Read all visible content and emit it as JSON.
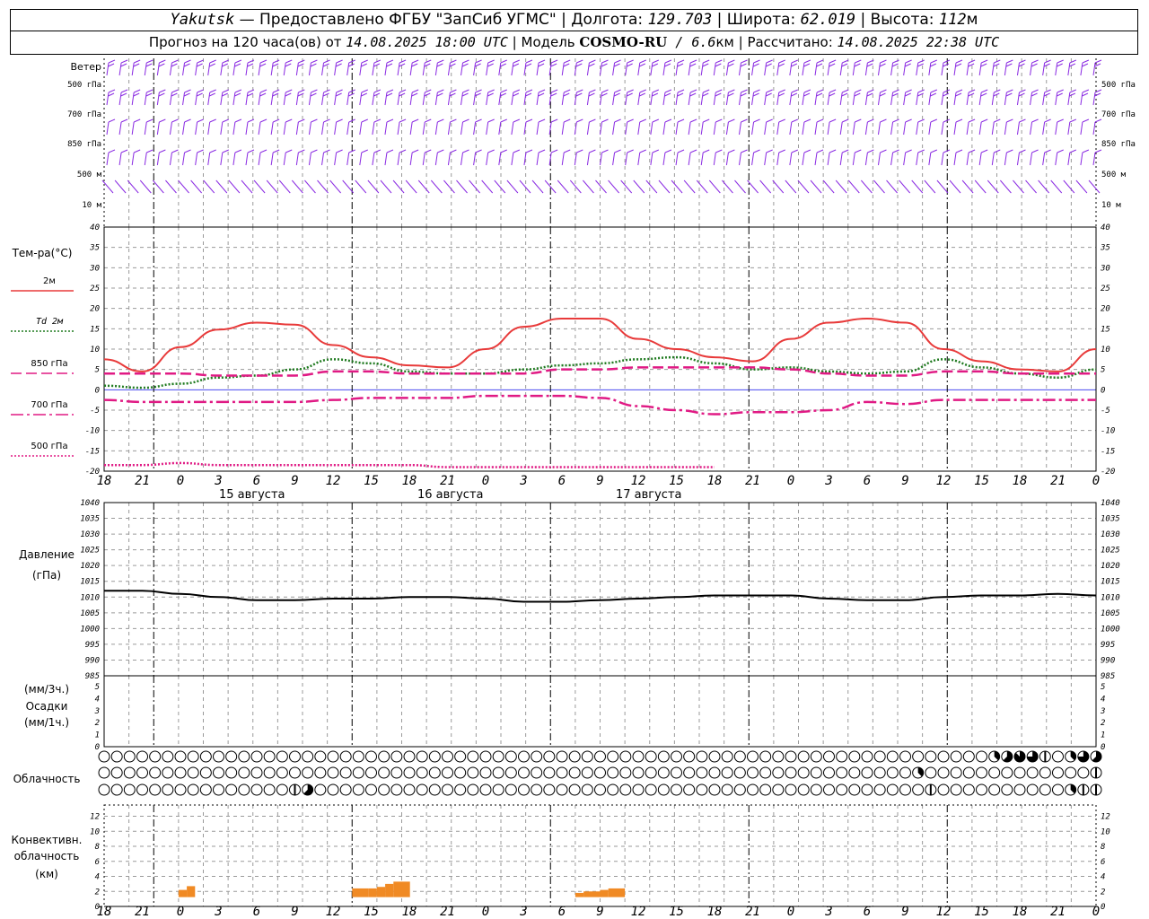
{
  "header": {
    "station": "Yakutsk",
    "dash": " — ",
    "provider": "Предоставлено ФГБУ \"ЗапСиб УГМС\"",
    "sep": " | ",
    "lon_label": "Долгота: ",
    "lon": "129.703",
    "lat_label": "Широта: ",
    "lat": "62.019",
    "alt_label": "Высота: ",
    "alt": "112",
    "alt_unit": "м",
    "forecast_label": "Прогноз на 120 часа(ов) от ",
    "forecast_start": "14.08.2025 18:00 UTC",
    "model_label": "Модель ",
    "model": "COSMO-RU",
    "model_res": " / 6.6",
    "model_res_unit": "км",
    "calc_label": "Рассчитано: ",
    "calc_time": "14.08.2025 22:38 UTC"
  },
  "colors": {
    "wind": "#8a2be2",
    "t2m": "#e83a3a",
    "td2m": "#1f7a1f",
    "t850": "#e01a84",
    "t700": "#e01a84",
    "t500": "#e01a84",
    "pressure": "#000000",
    "convective": "#f08a24",
    "grid": "#9a9a9a",
    "zero_line": "#4a4af0"
  },
  "chart_data": [
    {
      "type": "wind_barbs",
      "title": "Ветер",
      "levels": [
        "500 гПа",
        "700 гПа",
        "850 гПа",
        "500 м",
        "10 м"
      ],
      "x_hours": [
        18,
        19,
        20,
        21,
        22,
        23,
        0,
        1,
        2,
        3,
        4,
        5,
        6,
        7,
        8,
        9,
        10,
        11,
        12,
        13,
        14,
        15,
        16,
        17,
        18,
        19,
        20,
        21,
        22,
        23,
        0,
        1,
        2,
        3,
        4,
        5,
        6,
        7,
        8,
        9,
        10,
        11,
        12,
        13,
        14,
        15,
        16,
        17,
        18,
        19,
        20,
        21,
        22,
        23,
        0,
        1,
        2,
        3,
        4,
        5,
        6,
        7,
        8,
        9,
        10,
        11,
        12,
        13,
        14,
        15,
        16,
        17,
        18,
        19,
        20,
        21,
        22,
        23,
        0
      ],
      "direction_deg": {
        "500 гПа": [
          270,
          270,
          270,
          270,
          270,
          270,
          270,
          270,
          270,
          270,
          270,
          270,
          270,
          270,
          270,
          270,
          270,
          270,
          270,
          270,
          270,
          270,
          270,
          270,
          270,
          270,
          270,
          270,
          270,
          270,
          270,
          270,
          270,
          270,
          270,
          270,
          270,
          270,
          270,
          270,
          270,
          270,
          270,
          270,
          270,
          270,
          270,
          270,
          270,
          270,
          270,
          270,
          270,
          270,
          250,
          250,
          250,
          250,
          260,
          260,
          260,
          260,
          265,
          265,
          270,
          270,
          270,
          275,
          275,
          275,
          280,
          280,
          280,
          280,
          280,
          280,
          280,
          280,
          270
        ],
        "700 гПа": [
          280,
          280,
          280,
          280,
          280,
          280,
          280,
          280,
          280,
          280,
          280,
          280,
          280,
          280,
          280,
          280,
          280,
          280,
          280,
          280,
          280,
          280,
          280,
          280,
          280,
          280,
          280,
          280,
          280,
          280,
          280,
          280,
          280,
          280,
          280,
          280,
          280,
          280,
          280,
          280,
          280,
          280,
          280,
          280,
          280,
          280,
          280,
          280,
          280,
          280,
          280,
          280,
          280,
          280,
          270,
          270,
          270,
          270,
          270,
          270,
          270,
          270,
          270,
          270,
          270,
          270,
          270,
          270,
          270,
          270,
          270,
          270,
          270,
          270,
          270,
          270,
          270,
          270,
          270
        ],
        "850 гПа": [
          290,
          290,
          290,
          290,
          290,
          290,
          290,
          290,
          290,
          290,
          290,
          290,
          290,
          290,
          290,
          290,
          290,
          290,
          290,
          290,
          290,
          290,
          290,
          290,
          290,
          290,
          290,
          290,
          290,
          290,
          290,
          290,
          290,
          290,
          290,
          290,
          290,
          290,
          290,
          290,
          290,
          290,
          290,
          290,
          290,
          290,
          290,
          290,
          290,
          290,
          290,
          290,
          290,
          290,
          290,
          290,
          290,
          290,
          290,
          290,
          290,
          290,
          290,
          290,
          290,
          290,
          290,
          290,
          290,
          290,
          270,
          250,
          240,
          230,
          230,
          240,
          250,
          260,
          270
        ],
        "500 м": [
          300,
          300,
          300,
          300,
          300,
          300,
          300,
          300,
          300,
          300,
          300,
          300,
          300,
          300,
          300,
          300,
          300,
          300,
          300,
          300,
          300,
          300,
          300,
          300,
          300,
          300,
          300,
          300,
          300,
          300,
          300,
          300,
          300,
          300,
          300,
          300,
          300,
          300,
          300,
          300,
          300,
          300,
          300,
          300,
          300,
          300,
          300,
          300,
          300,
          300,
          300,
          300,
          300,
          300,
          310,
          310,
          310,
          310,
          310,
          310,
          310,
          310,
          310,
          310,
          310,
          310,
          310,
          310,
          310,
          310,
          310,
          310,
          310,
          300,
          290,
          280,
          270,
          260,
          250
        ],
        "10 м": [
          315,
          315,
          315,
          315,
          315,
          315,
          315,
          320,
          320,
          320,
          320,
          320,
          320,
          320,
          320,
          320,
          320,
          320,
          320,
          320,
          320,
          320,
          320,
          320,
          320,
          320,
          320,
          320,
          320,
          320,
          320,
          320,
          320,
          320,
          320,
          320,
          320,
          320,
          320,
          320,
          320,
          320,
          320,
          320,
          320,
          320,
          320,
          320,
          320,
          320,
          320,
          320,
          320,
          320,
          330,
          330,
          330,
          330,
          330,
          330,
          330,
          330,
          330,
          330,
          330,
          330,
          330,
          330,
          330,
          330,
          330,
          330,
          330,
          320,
          310,
          300,
          300,
          300,
          300
        ]
      }
    },
    {
      "type": "line",
      "title": "Тем-ра(°C)",
      "x_hours": [
        18,
        21,
        0,
        3,
        6,
        9,
        12,
        15,
        18,
        21,
        0,
        3,
        6,
        9,
        12,
        15,
        18,
        21,
        0,
        3,
        6,
        9,
        12,
        15,
        18,
        21,
        0
      ],
      "x_ticks": [
        "18",
        "21",
        "0",
        "3",
        "6",
        "9",
        "12",
        "15",
        "18",
        "21",
        "0",
        "3",
        "6",
        "9",
        "12",
        "15",
        "18",
        "21",
        "0",
        "3",
        "6",
        "9",
        "12",
        "15",
        "18",
        "21",
        "0"
      ],
      "dates": [
        "15 августа",
        "16 августа",
        "17 августа"
      ],
      "ylim": [
        -20,
        40
      ],
      "y_ticks": [
        "40",
        "35",
        "30",
        "25",
        "20",
        "15",
        "10",
        "5",
        "0",
        "-5",
        "-10",
        "-15",
        "-20"
      ],
      "grid": true,
      "series": [
        {
          "name": "2м",
          "style": "solid",
          "values": [
            7.5,
            4.5,
            10.5,
            14.8,
            16.5,
            16,
            11,
            8,
            6,
            5.5,
            10,
            15.5,
            17.5,
            17.5,
            12.5,
            10,
            8,
            7,
            12.5,
            16.5,
            17.5,
            16.5,
            10,
            7,
            5,
            4.5,
            10
          ]
        },
        {
          "name": "Td 2м",
          "style": "dotted",
          "values": [
            1,
            0.5,
            1.5,
            3,
            3.5,
            5,
            7.5,
            6.5,
            4.5,
            4,
            4,
            5,
            6,
            6.5,
            7.5,
            8,
            6.5,
            5,
            5.5,
            4.5,
            4,
            4.5,
            7.5,
            5.5,
            4,
            3,
            5
          ]
        },
        {
          "name": "850 гПа",
          "style": "dashed",
          "values": [
            4,
            4,
            4,
            3.5,
            3.5,
            3.5,
            4.5,
            4.5,
            4,
            4,
            4,
            4,
            5,
            5,
            5.5,
            5.5,
            5.5,
            5.5,
            5,
            4,
            3.5,
            3.5,
            4.5,
            4.5,
            4,
            4,
            4
          ]
        },
        {
          "name": "700 гПа",
          "style": "dashdot",
          "values": [
            -2.5,
            -3,
            -3,
            -3,
            -3,
            -3,
            -2.5,
            -2,
            -2,
            -2,
            -1.5,
            -1.5,
            -1.5,
            -2,
            -4,
            -5,
            -6,
            -5.5,
            -5.5,
            -5,
            -3,
            -3.5,
            -2.5,
            -2.5,
            -2.5,
            -2.5,
            -2.5
          ]
        },
        {
          "name": "500 гПа",
          "style": "dotted",
          "values": [
            -18.5,
            -18.5,
            -18,
            -18.5,
            -18.5,
            -18.5,
            -18.5,
            -18.5,
            -18.5,
            -19,
            -19,
            -19,
            -19,
            -19,
            -19,
            -19,
            -19
          ]
        }
      ]
    },
    {
      "type": "line",
      "title": "Давление",
      "ylabel": "(гПа)",
      "ylim": [
        985,
        1040
      ],
      "y_ticks": [
        "1040",
        "1035",
        "1030",
        "1025",
        "1020",
        "1015",
        "1010",
        "1005",
        "1000",
        "995",
        "990",
        "985"
      ],
      "x_hours": [
        18,
        21,
        0,
        3,
        6,
        9,
        12,
        15,
        18,
        21,
        0,
        3,
        6,
        9,
        12,
        15,
        18,
        21,
        0,
        3,
        6,
        9,
        12,
        15,
        18,
        21,
        0
      ],
      "grid": true,
      "series": [
        {
          "name": "",
          "values": [
            1012,
            1012,
            1011,
            1010,
            1009,
            1009,
            1009.5,
            1009.5,
            1010,
            1010,
            1009.5,
            1008.5,
            1008.5,
            1009,
            1009.5,
            1010,
            1010.5,
            1010.5,
            1010.5,
            1009.5,
            1009,
            1009,
            1010,
            1010.5,
            1010.5,
            1011,
            1010.5
          ]
        }
      ]
    },
    {
      "type": "bar",
      "title": "Осадки",
      "ylabel_top": "(мм/3ч.)",
      "ylabel_bottom": "(мм/1ч.)",
      "ylim": [
        0,
        5
      ],
      "y_ticks": [
        "5",
        "4",
        "3",
        "2",
        "1",
        "0"
      ],
      "values": []
    },
    {
      "type": "cloud_cover",
      "title": "Облачность",
      "rows": [
        "upper",
        "middle",
        "lower"
      ],
      "x_hours": [
        18,
        19,
        20,
        21,
        22,
        23,
        0,
        1,
        2,
        3,
        4,
        5,
        6,
        7,
        8,
        9,
        10,
        11,
        12,
        13,
        14,
        15,
        16,
        17,
        18,
        19,
        20,
        21,
        22,
        23,
        0,
        1,
        2,
        3,
        4,
        5,
        6,
        7,
        8,
        9,
        10,
        11,
        12,
        13,
        14,
        15,
        16,
        17,
        18,
        19,
        20,
        21,
        22,
        23,
        0,
        1,
        2,
        3,
        4,
        5,
        6,
        7,
        8,
        9,
        10,
        11,
        12,
        13,
        14,
        15,
        16,
        17,
        18,
        19,
        20,
        21,
        22,
        23,
        0
      ],
      "oktas": {
        "upper": [
          0,
          0,
          0,
          0,
          0,
          0,
          0,
          0,
          0,
          0,
          0,
          0,
          0,
          0,
          0,
          0,
          0,
          0,
          0,
          0,
          0,
          0,
          0,
          0,
          0,
          0,
          0,
          0,
          0,
          0,
          0,
          0,
          0,
          0,
          0,
          0,
          0,
          0,
          0,
          0,
          0,
          0,
          0,
          0,
          0,
          0,
          0,
          0,
          0,
          0,
          0,
          0,
          0,
          0,
          0,
          0,
          0,
          0,
          0,
          0,
          0,
          0,
          0,
          0,
          0,
          0,
          0,
          0,
          0,
          0,
          3,
          5,
          7,
          6,
          4,
          0,
          3,
          6,
          5
        ],
        "middle": [
          0,
          0,
          0,
          0,
          0,
          0,
          0,
          0,
          0,
          0,
          0,
          0,
          0,
          0,
          0,
          0,
          0,
          0,
          0,
          0,
          0,
          0,
          0,
          0,
          0,
          0,
          0,
          0,
          0,
          0,
          0,
          0,
          0,
          0,
          0,
          0,
          0,
          0,
          0,
          0,
          0,
          0,
          0,
          0,
          0,
          0,
          0,
          0,
          0,
          0,
          0,
          0,
          0,
          0,
          0,
          0,
          0,
          0,
          0,
          0,
          0,
          0,
          0,
          0,
          3,
          0,
          0,
          0,
          0,
          0,
          0,
          0,
          0,
          0,
          0,
          0,
          0,
          0,
          4
        ],
        "lower": [
          0,
          0,
          0,
          0,
          0,
          0,
          0,
          0,
          0,
          0,
          0,
          0,
          0,
          0,
          0,
          4,
          5,
          0,
          0,
          0,
          0,
          0,
          0,
          0,
          0,
          0,
          0,
          0,
          0,
          0,
          0,
          0,
          0,
          0,
          0,
          0,
          0,
          0,
          0,
          0,
          0,
          0,
          0,
          0,
          0,
          0,
          0,
          0,
          0,
          0,
          0,
          0,
          0,
          0,
          0,
          0,
          0,
          0,
          0,
          0,
          0,
          0,
          0,
          0,
          0,
          4,
          0,
          0,
          0,
          0,
          0,
          0,
          0,
          0,
          0,
          0,
          3,
          4,
          4
        ]
      }
    },
    {
      "type": "bar",
      "title": "Конвективн. облачность",
      "ylabel": "(км)",
      "ylim": [
        0,
        13
      ],
      "y_ticks": [
        "12",
        "10",
        "8",
        "6",
        "4",
        "2",
        "0"
      ],
      "bars": [
        {
          "from_h": 9,
          "to_h": 10,
          "value": 2.2
        },
        {
          "from_h": 10,
          "to_h": 11,
          "value": 2.7
        },
        {
          "from_h": 30,
          "to_h": 32,
          "value": 2.4
        },
        {
          "from_h": 32,
          "to_h": 33,
          "value": 2.4
        },
        {
          "from_h": 33,
          "to_h": 34,
          "value": 2.6
        },
        {
          "from_h": 34,
          "to_h": 35,
          "value": 3.0
        },
        {
          "from_h": 35,
          "to_h": 37,
          "value": 3.3
        },
        {
          "from_h": 57,
          "to_h": 58,
          "value": 1.8
        },
        {
          "from_h": 58,
          "to_h": 60,
          "value": 2.0
        },
        {
          "from_h": 60,
          "to_h": 61,
          "value": 2.2
        },
        {
          "from_h": 61,
          "to_h": 63,
          "value": 2.4
        }
      ]
    }
  ],
  "side_labels": {
    "wind": "Ветер",
    "levels": [
      "500 гПа",
      "700 гПа",
      "850 гПа",
      "500 м",
      "10 м"
    ],
    "temp": "Тем-ра(°C)",
    "legend": [
      "2м",
      "Td 2м",
      "850 гПа",
      "700 гПа",
      "500 гПа"
    ],
    "pressure": "Давление",
    "pressure_unit": "(гПа)",
    "precip_top": "(мм/3ч.)",
    "precip": "Осадки",
    "precip_bottom": "(мм/1ч.)",
    "cloud": "Облачность",
    "conv1": "Конвективн.",
    "conv2": "облачность",
    "conv3": "(км)"
  }
}
